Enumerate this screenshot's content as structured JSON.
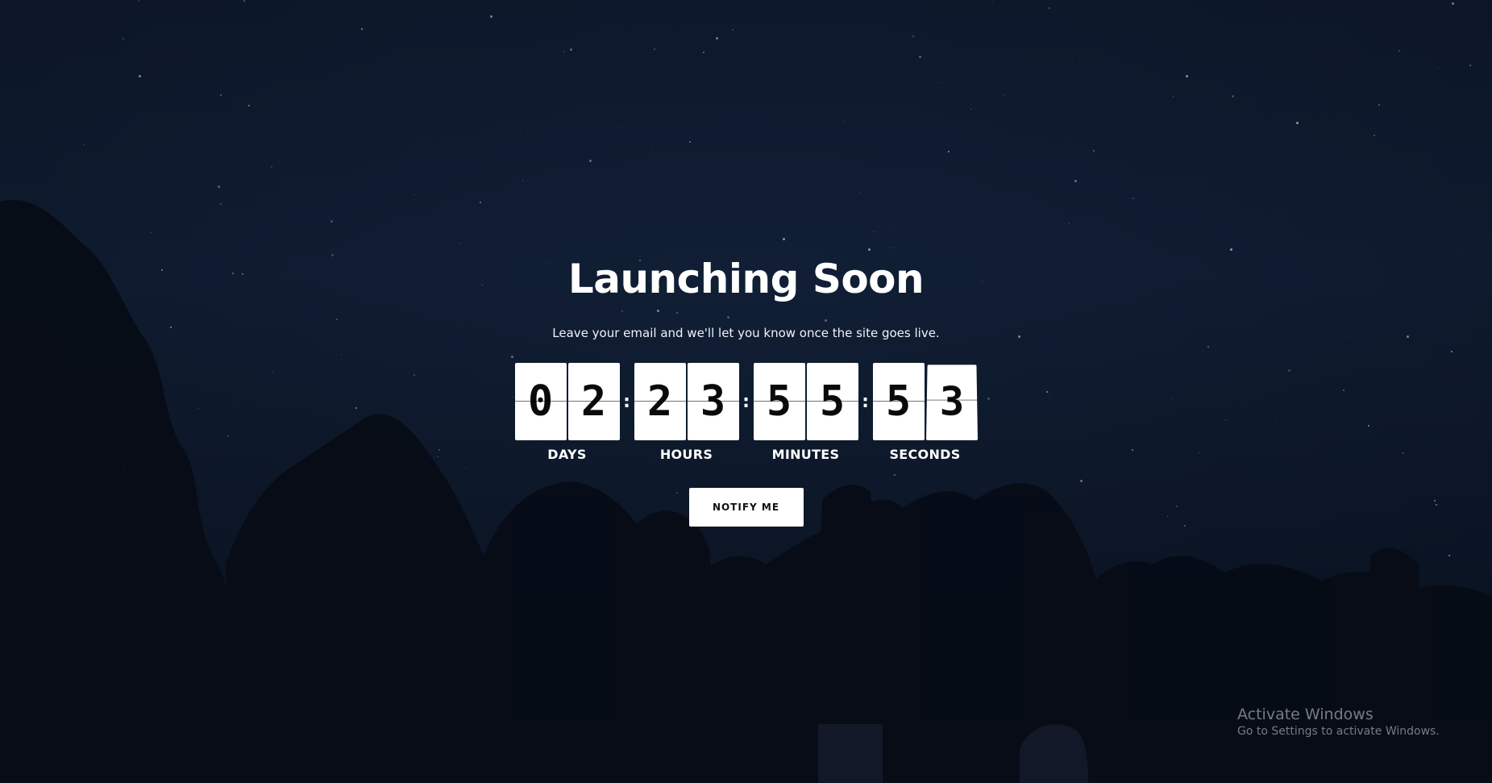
{
  "page": {
    "title": "Launching Soon",
    "subtitle": "Leave your email and we'll let you know once the site goes live."
  },
  "countdown": {
    "days": {
      "digits": [
        "0",
        "2"
      ],
      "label": "DAYS"
    },
    "hours": {
      "digits": [
        "2",
        "3"
      ],
      "label": "HOURS"
    },
    "minutes": {
      "digits": [
        "5",
        "5"
      ],
      "label": "MINUTES"
    },
    "seconds": {
      "digits": [
        "5",
        "3"
      ],
      "label": "SECONDS"
    },
    "separator": ":"
  },
  "cta": {
    "notify_label": "NOTIFY ME"
  },
  "os_watermark": {
    "title": "Activate Windows",
    "subtitle": "Go to Settings to activate Windows."
  },
  "colors": {
    "background": "#0f1b30",
    "tile": "#ffffff",
    "digit": "#0a0a0a",
    "text": "#ffffff"
  }
}
